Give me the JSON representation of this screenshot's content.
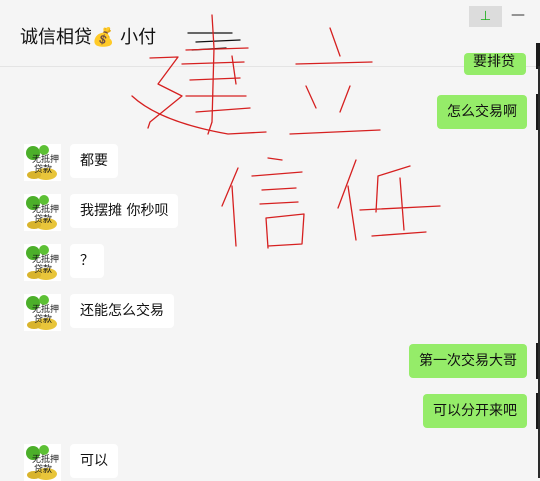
{
  "window": {
    "chat_title": "诚信相贷💰 小付",
    "pin_icon": "pin-icon",
    "pin_glyph": "⊥",
    "minimize_icon": "minimize-icon",
    "minimize_glyph": "—"
  },
  "messages": [
    {
      "side": "out",
      "text": "要排贷",
      "partial": true
    },
    {
      "side": "out",
      "text": "怎么交易啊"
    },
    {
      "side": "in",
      "text": "都要"
    },
    {
      "side": "in",
      "text": "我摆摊 你秒呗"
    },
    {
      "side": "in",
      "text": "？"
    },
    {
      "side": "in",
      "text": "还能怎么交易"
    },
    {
      "side": "out",
      "text": "第一次交易大哥"
    },
    {
      "side": "out",
      "text": "可以分开来吧"
    },
    {
      "side": "in",
      "text": "可以"
    }
  ],
  "avatar": {
    "lettering": "无抵押贷款",
    "colors": {
      "leaf": "#4caf2a",
      "coin": "#e8c53a",
      "text": "#1a1a1a"
    }
  },
  "overlay": {
    "annotation_text": "建立信任",
    "stroke_color": "#d62020"
  },
  "colors": {
    "background": "#f5f5f5",
    "incoming_bubble": "#ffffff",
    "outgoing_bubble": "#95ec69"
  }
}
